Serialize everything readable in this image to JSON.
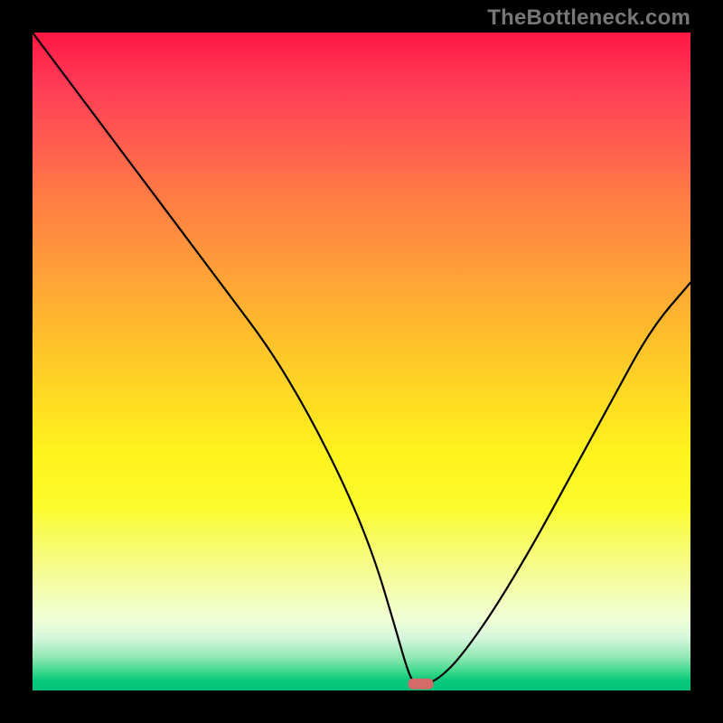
{
  "watermark": "TheBottleneck.com",
  "chart_data": {
    "type": "line",
    "title": "",
    "xlabel": "",
    "ylabel": "",
    "xlim": [
      0,
      100
    ],
    "ylim": [
      0,
      100
    ],
    "x": [
      0,
      6,
      12,
      18,
      24,
      30,
      36,
      42,
      48,
      52,
      55,
      57,
      58,
      60,
      62,
      65,
      70,
      76,
      82,
      88,
      94,
      100
    ],
    "values": [
      100,
      92,
      84,
      76,
      68,
      60,
      52,
      42,
      30,
      20,
      10,
      3,
      1,
      1,
      2,
      5,
      12,
      22,
      33,
      44,
      55,
      62
    ],
    "marker": {
      "x": 59,
      "y": 1,
      "color": "#d46a6a"
    },
    "background_gradient": {
      "stops": [
        {
          "pct": 0,
          "color": "#ff1744"
        },
        {
          "pct": 50,
          "color": "#ffdc22"
        },
        {
          "pct": 80,
          "color": "#f7fc6c"
        },
        {
          "pct": 100,
          "color": "#02c37a"
        }
      ]
    }
  }
}
